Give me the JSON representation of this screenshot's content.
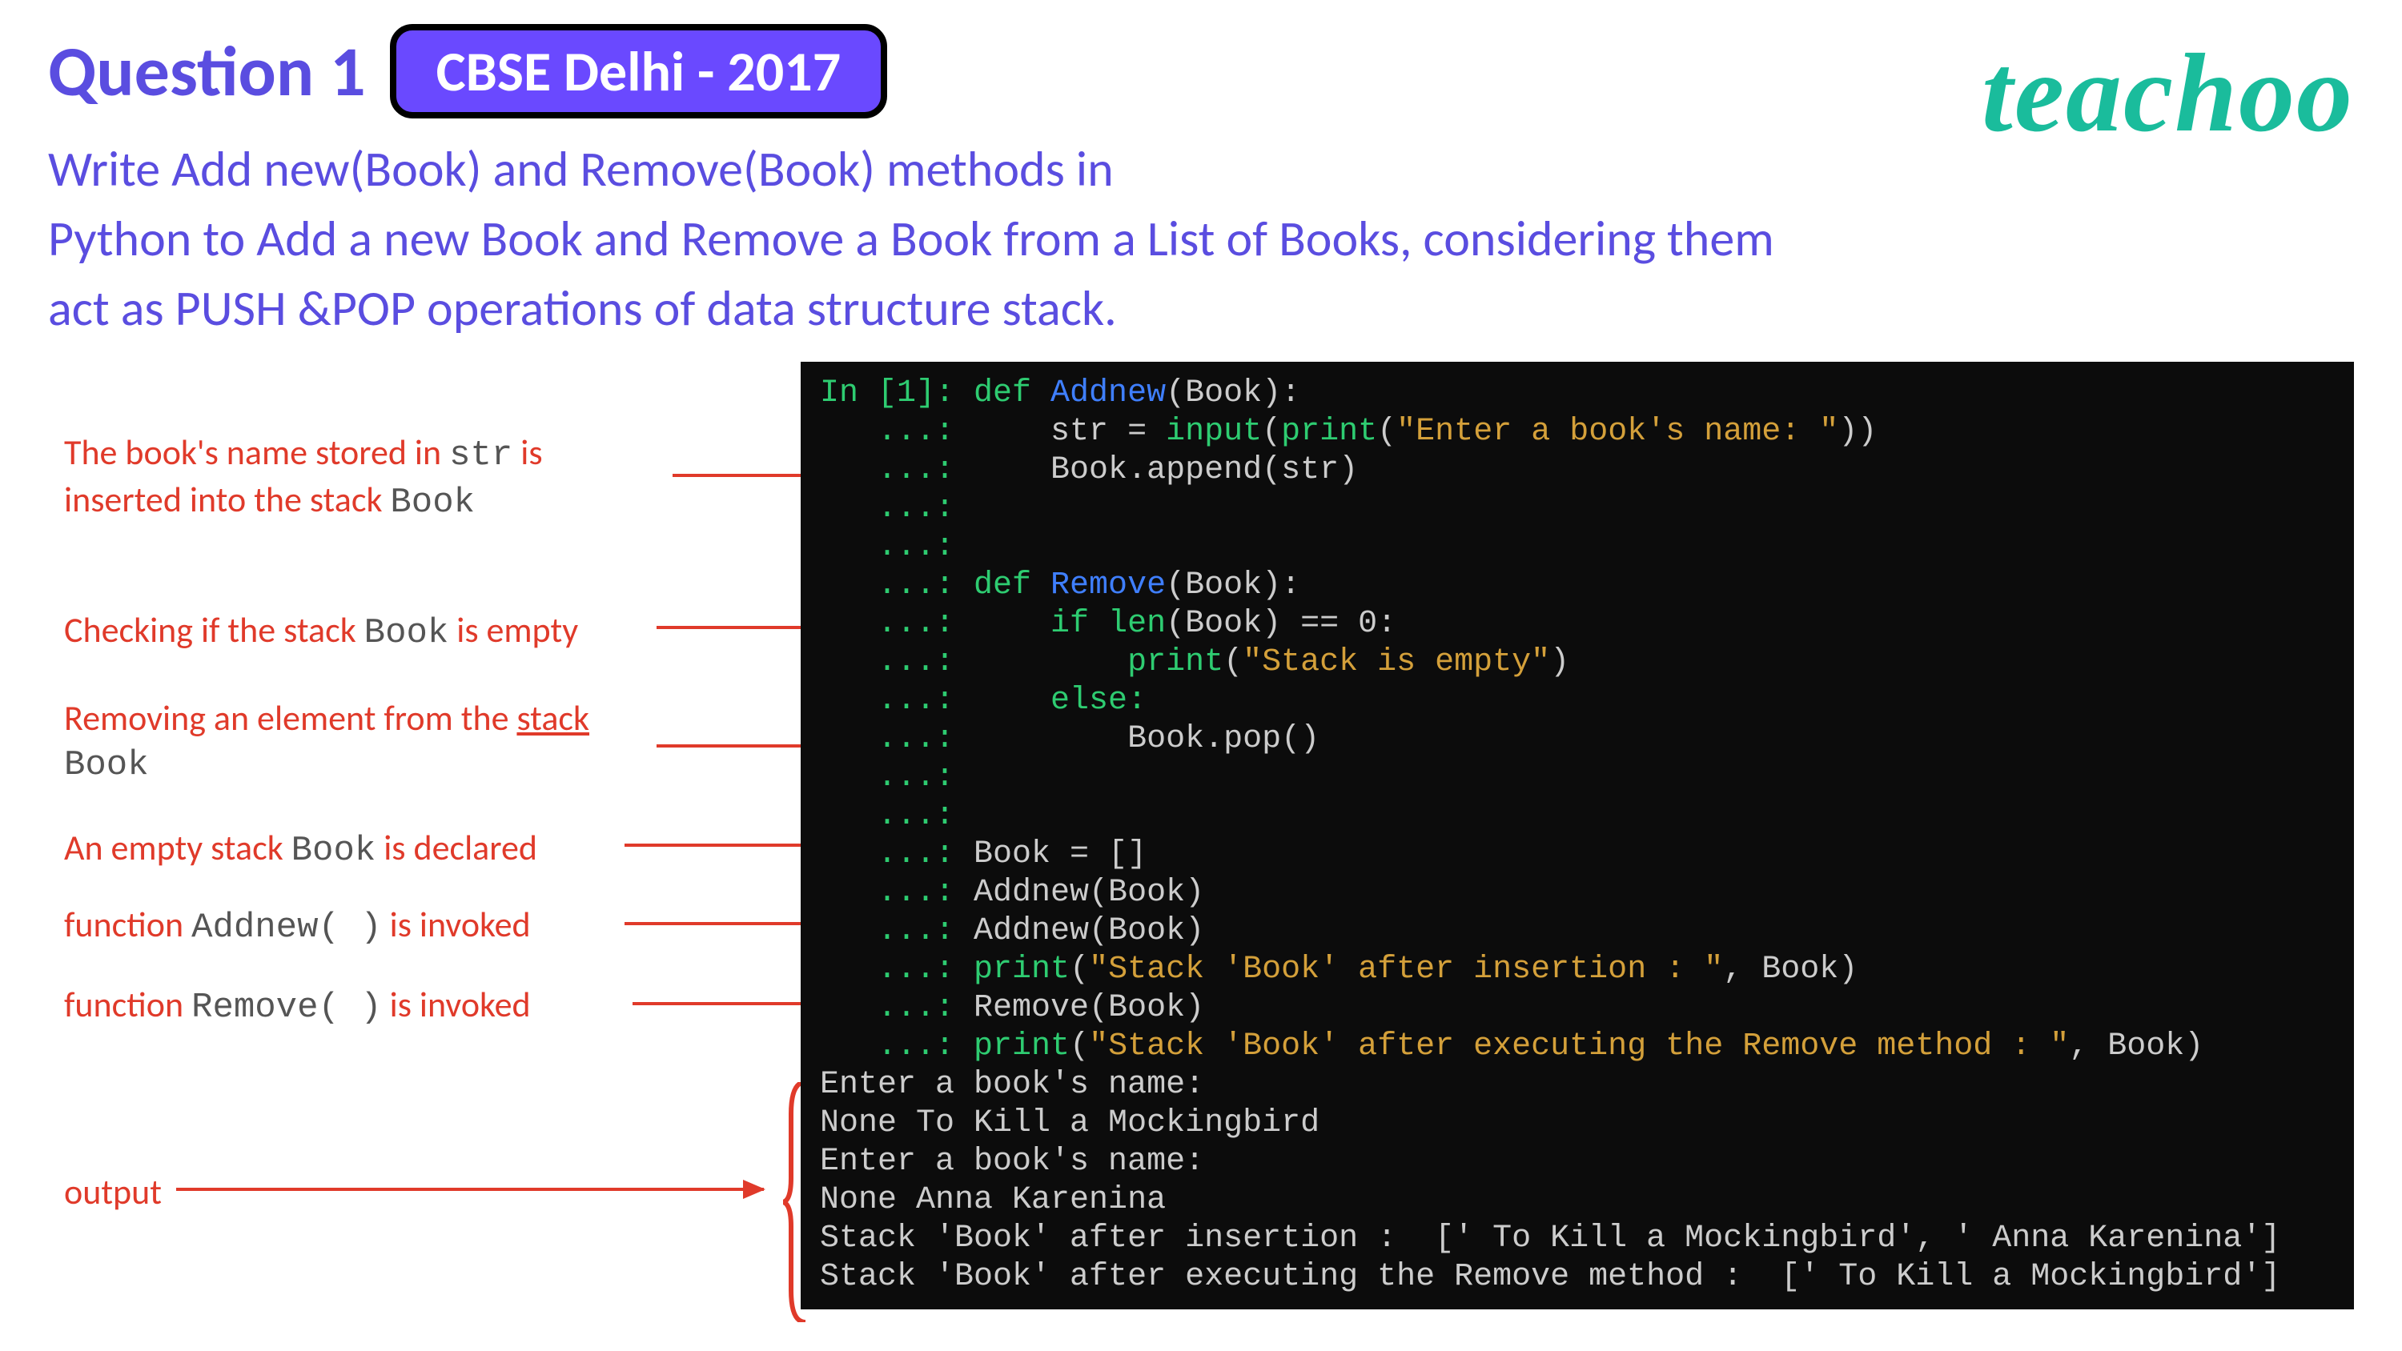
{
  "header": {
    "question_title": "Question 1",
    "badge": "CBSE Delhi - 2017",
    "logo": "teachoo"
  },
  "question_text": "Write Add new(Book) and Remove(Book) methods in\nPython to Add a new Book and Remove a  Book from a List of Books, considering them\nact  as PUSH &POP operations of data structure  stack.",
  "annotations": {
    "a1_pre": "The book's name stored in ",
    "a1_code1": "str",
    "a1_mid": " is\ninserted into the stack  ",
    "a1_code2": "Book",
    "a2_pre": "Checking if the stack ",
    "a2_code": "Book",
    "a2_post": " is empty",
    "a3_pre": "Removing an element from the ",
    "a3_underline": "stack",
    "a3_code": "Book",
    "a4_pre": "An empty stack ",
    "a4_code": "Book",
    "a4_post": " is declared",
    "a5_pre": "function ",
    "a5_code": "Addnew( )",
    "a5_post": "  is invoked",
    "a6_pre": "function ",
    "a6_code": "Remove( )",
    "a6_post": " is invoked",
    "a7": "output"
  },
  "code": {
    "in_label": "In [1]: ",
    "cont": "   ...: ",
    "l1a": "def ",
    "l1b": "Addnew",
    "l1c": "(Book):",
    "l2a": "    str = ",
    "l2b": "input",
    "l2c": "(",
    "l2d": "print",
    "l2e": "(",
    "l2f": "\"Enter a book's name: \"",
    "l2g": "))",
    "l3": "    Book.append(str)",
    "l6a": "def ",
    "l6b": "Remove",
    "l6c": "(Book):",
    "l7a": "    if ",
    "l7b": "len",
    "l7c": "(Book) == 0:",
    "l8a": "        ",
    "l8b": "print",
    "l8c": "(",
    "l8d": "\"Stack is empty\"",
    "l8e": ")",
    "l9": "    else:",
    "l10": "        Book.pop()",
    "l13": "Book = []",
    "l14": "Addnew(Book)",
    "l15": "Addnew(Book)",
    "l16a": "print",
    "l16b": "(",
    "l16c": "\"Stack 'Book' after insertion : \"",
    "l16d": ", Book)",
    "l17": "Remove(Book)",
    "l18a": "print",
    "l18b": "(",
    "l18c": "\"Stack 'Book' after executing the Remove method : \"",
    "l18d": ", Book)",
    "out1": "Enter a book's name:",
    "out2": "None To Kill a Mockingbird",
    "out3": "Enter a book's name:",
    "out4": "None Anna Karenina",
    "out5": "Stack 'Book' after insertion :  [' To Kill a Mockingbird', ' Anna Karenina']",
    "out6": "Stack 'Book' after executing the Remove method :  [' To Kill a Mockingbird']"
  }
}
